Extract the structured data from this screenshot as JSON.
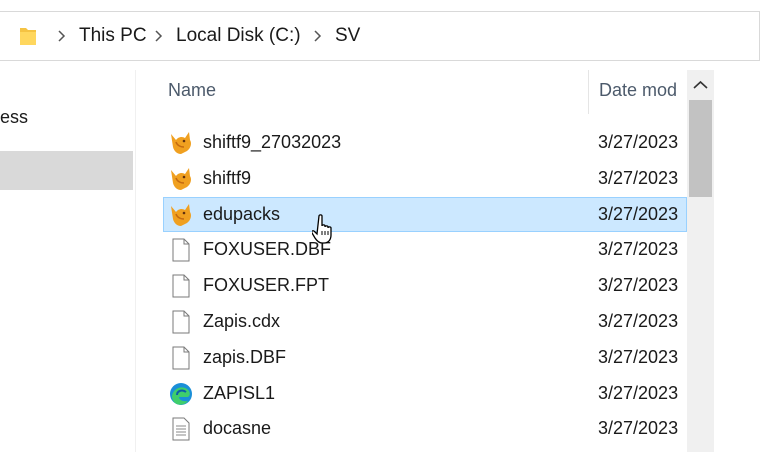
{
  "address_bar": {
    "breadcrumbs": [
      "This PC",
      "Local Disk (C:)",
      "SV"
    ]
  },
  "sidebar": {
    "partial_label": "ess"
  },
  "columns": {
    "name": "Name",
    "date_modified": "Date mod"
  },
  "files": [
    {
      "name": "shiftf9_27032023",
      "date": "3/27/2023",
      "icon": "foxpro-icon"
    },
    {
      "name": "shiftf9",
      "date": "3/27/2023",
      "icon": "foxpro-icon"
    },
    {
      "name": "edupacks",
      "date": "3/27/2023",
      "icon": "foxpro-icon",
      "selected": true
    },
    {
      "name": "FOXUSER.DBF",
      "date": "3/27/2023",
      "icon": "blank-file-icon"
    },
    {
      "name": "FOXUSER.FPT",
      "date": "3/27/2023",
      "icon": "blank-file-icon"
    },
    {
      "name": "Zapis.cdx",
      "date": "3/27/2023",
      "icon": "blank-file-icon"
    },
    {
      "name": "zapis.DBF",
      "date": "3/27/2023",
      "icon": "blank-file-icon"
    },
    {
      "name": "ZAPISL1",
      "date": "3/27/2023",
      "icon": "edge-icon"
    },
    {
      "name": "docasne",
      "date": "3/27/2023",
      "icon": "text-file-icon"
    }
  ],
  "colors": {
    "selection_fill": "#cce8ff",
    "selection_border": "#99d1ff",
    "header_text": "#4c5a6b"
  }
}
